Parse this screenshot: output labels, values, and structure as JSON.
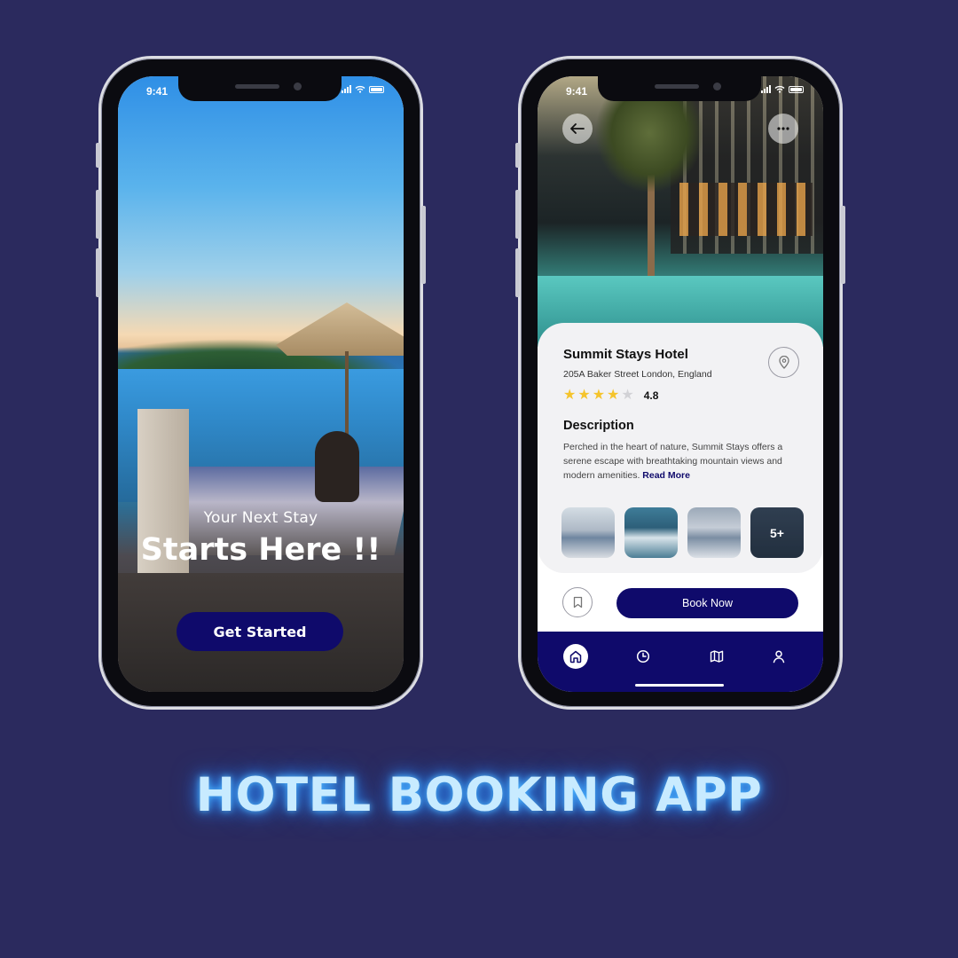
{
  "status_bar": {
    "time": "9:41"
  },
  "welcome": {
    "subtitle": "Your Next Stay",
    "title": "Starts Here !!",
    "cta_label": "Get Started"
  },
  "hotel": {
    "name": "Summit Stays Hotel",
    "address": "205A Baker Street London, England",
    "rating": "4.8",
    "stars_filled": 4,
    "stars_total": 5,
    "description_title": "Description",
    "description": "Perched in the heart of nature, Summit Stays offers a serene escape with breathtaking mountain views and modern amenities.",
    "read_more": "Read More",
    "gallery_more": "5+",
    "book_label": "Book Now"
  },
  "nav": {
    "items": [
      "home-icon",
      "clock-icon",
      "map-icon",
      "profile-icon"
    ],
    "active": "home-icon"
  },
  "caption": "HOTEL BOOKING APP",
  "colors": {
    "background": "#2b2a5e",
    "brand": "#0f0a6b",
    "star": "#f5c42c",
    "caption_glow": "#4fb8ff"
  }
}
